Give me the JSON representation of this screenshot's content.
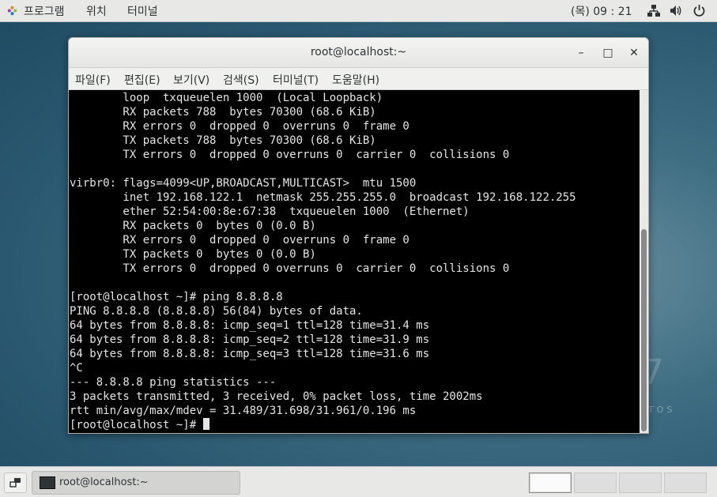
{
  "topbar": {
    "programs": "프로그램",
    "places": "위치",
    "terminal": "터미널",
    "clock": "(목) 09 : 21",
    "icons": [
      "network-icon",
      "volume-icon",
      "power-icon"
    ]
  },
  "desktop": {
    "watermark_number": "7",
    "watermark_text": "TOS"
  },
  "window": {
    "title": "root@localhost:~",
    "buttons": {
      "minimize": "–",
      "maximize": "□",
      "close": "✕"
    },
    "menu": [
      "파일(F)",
      "편집(E)",
      "보기(V)",
      "검색(S)",
      "터미널(T)",
      "도움말(H)"
    ]
  },
  "terminal": {
    "lines": [
      "        loop  txqueuelen 1000  (Local Loopback)",
      "        RX packets 788  bytes 70300 (68.6 KiB)",
      "        RX errors 0  dropped 0  overruns 0  frame 0",
      "        TX packets 788  bytes 70300 (68.6 KiB)",
      "        TX errors 0  dropped 0 overruns 0  carrier 0  collisions 0",
      "",
      "virbr0: flags=4099<UP,BROADCAST,MULTICAST>  mtu 1500",
      "        inet 192.168.122.1  netmask 255.255.255.0  broadcast 192.168.122.255",
      "        ether 52:54:00:8e:67:38  txqueuelen 1000  (Ethernet)",
      "        RX packets 0  bytes 0 (0.0 B)",
      "        RX errors 0  dropped 0  overruns 0  frame 0",
      "        TX packets 0  bytes 0 (0.0 B)",
      "        TX errors 0  dropped 0 overruns 0  carrier 0  collisions 0",
      "",
      "[root@localhost ~]# ping 8.8.8.8",
      "PING 8.8.8.8 (8.8.8.8) 56(84) bytes of data.",
      "64 bytes from 8.8.8.8: icmp_seq=1 ttl=128 time=31.4 ms",
      "64 bytes from 8.8.8.8: icmp_seq=2 ttl=128 time=31.9 ms",
      "64 bytes from 8.8.8.8: icmp_seq=3 ttl=128 time=31.6 ms",
      "^C",
      "--- 8.8.8.8 ping statistics ---",
      "3 packets transmitted, 3 received, 0% packet loss, time 2002ms",
      "rtt min/avg/max/mdev = 31.489/31.698/31.961/0.196 ms"
    ],
    "prompt": "[root@localhost ~]# "
  },
  "taskbar": {
    "task_label": "root@localhost:~",
    "workspaces": 4,
    "active_workspace": 1
  }
}
